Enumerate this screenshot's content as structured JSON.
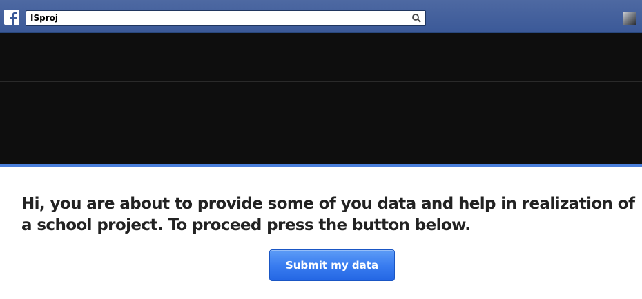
{
  "topbar": {
    "logo_icon": "facebook-f-icon",
    "search": {
      "value": "ISproj",
      "icon": "search-icon"
    },
    "avatar_icon": "profile-avatar"
  },
  "main": {
    "message": "Hi, you are about to provide some of you data and help in realization of a school project. To proceed press the button below.",
    "submit_label": "Submit my data"
  },
  "colors": {
    "topbar": "#3b5998",
    "stripe": "#4a7fdb",
    "button": "#3a7df0",
    "dark_area": "#0e0e0e"
  }
}
